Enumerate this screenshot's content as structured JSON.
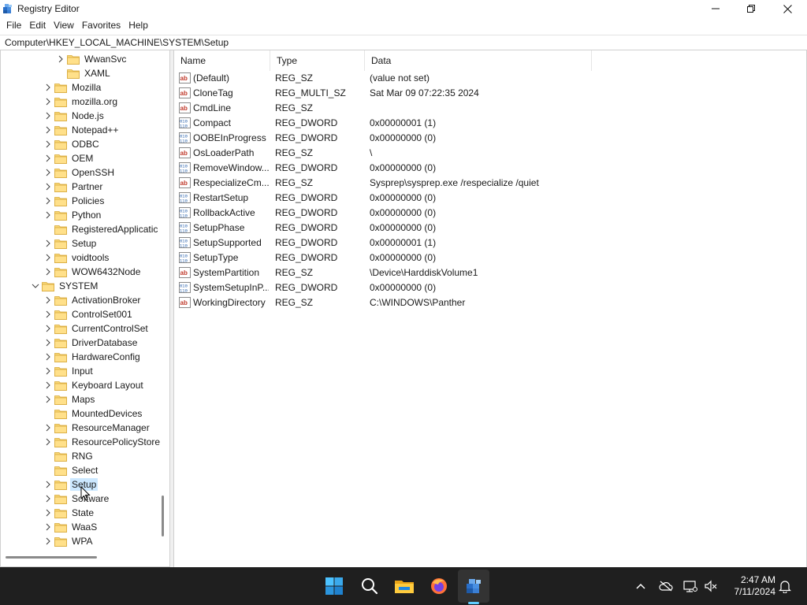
{
  "window": {
    "title": "Registry Editor",
    "controls": {
      "minimize": "minimize",
      "maximize": "maximize",
      "close": "close"
    }
  },
  "menu": [
    "File",
    "Edit",
    "View",
    "Favorites",
    "Help"
  ],
  "address": "Computer\\HKEY_LOCAL_MACHINE\\SYSTEM\\Setup",
  "tree": [
    {
      "label": "WwanSvc",
      "expander": "collapsed",
      "level": 3
    },
    {
      "label": "XAML",
      "expander": "none",
      "level": 3
    },
    {
      "label": "Mozilla",
      "expander": "collapsed",
      "level": 2
    },
    {
      "label": "mozilla.org",
      "expander": "collapsed",
      "level": 2
    },
    {
      "label": "Node.js",
      "expander": "collapsed",
      "level": 2
    },
    {
      "label": "Notepad++",
      "expander": "collapsed",
      "level": 2
    },
    {
      "label": "ODBC",
      "expander": "collapsed",
      "level": 2
    },
    {
      "label": "OEM",
      "expander": "collapsed",
      "level": 2
    },
    {
      "label": "OpenSSH",
      "expander": "collapsed",
      "level": 2
    },
    {
      "label": "Partner",
      "expander": "collapsed",
      "level": 2
    },
    {
      "label": "Policies",
      "expander": "collapsed",
      "level": 2
    },
    {
      "label": "Python",
      "expander": "collapsed",
      "level": 2
    },
    {
      "label": "RegisteredApplicatic",
      "expander": "none",
      "level": 2
    },
    {
      "label": "Setup",
      "expander": "collapsed",
      "level": 2
    },
    {
      "label": "voidtools",
      "expander": "collapsed",
      "level": 2
    },
    {
      "label": "WOW6432Node",
      "expander": "collapsed",
      "level": 2
    },
    {
      "label": "SYSTEM",
      "expander": "expanded",
      "level": 1
    },
    {
      "label": "ActivationBroker",
      "expander": "collapsed",
      "level": 2
    },
    {
      "label": "ControlSet001",
      "expander": "collapsed",
      "level": 2
    },
    {
      "label": "CurrentControlSet",
      "expander": "collapsed",
      "level": 2
    },
    {
      "label": "DriverDatabase",
      "expander": "collapsed",
      "level": 2
    },
    {
      "label": "HardwareConfig",
      "expander": "collapsed",
      "level": 2
    },
    {
      "label": "Input",
      "expander": "collapsed",
      "level": 2
    },
    {
      "label": "Keyboard Layout",
      "expander": "collapsed",
      "level": 2
    },
    {
      "label": "Maps",
      "expander": "collapsed",
      "level": 2
    },
    {
      "label": "MountedDevices",
      "expander": "none",
      "level": 2
    },
    {
      "label": "ResourceManager",
      "expander": "collapsed",
      "level": 2
    },
    {
      "label": "ResourcePolicyStore",
      "expander": "collapsed",
      "level": 2
    },
    {
      "label": "RNG",
      "expander": "none",
      "level": 2
    },
    {
      "label": "Select",
      "expander": "none",
      "level": 2
    },
    {
      "label": "Setup",
      "expander": "collapsed",
      "level": 2,
      "selected": true
    },
    {
      "label": "Software",
      "expander": "collapsed",
      "level": 2
    },
    {
      "label": "State",
      "expander": "collapsed",
      "level": 2
    },
    {
      "label": "WaaS",
      "expander": "collapsed",
      "level": 2
    },
    {
      "label": "WPA",
      "expander": "collapsed",
      "level": 2
    }
  ],
  "list": {
    "columns": [
      "Name",
      "Type",
      "Data"
    ],
    "rows": [
      {
        "name": "(Default)",
        "type": "REG_SZ",
        "data": "(value not set)",
        "icon": "string"
      },
      {
        "name": "CloneTag",
        "type": "REG_MULTI_SZ",
        "data": "Sat Mar 09 07:22:35 2024",
        "icon": "string"
      },
      {
        "name": "CmdLine",
        "type": "REG_SZ",
        "data": "",
        "icon": "string"
      },
      {
        "name": "Compact",
        "type": "REG_DWORD",
        "data": "0x00000001 (1)",
        "icon": "binary"
      },
      {
        "name": "OOBEInProgress",
        "type": "REG_DWORD",
        "data": "0x00000000 (0)",
        "icon": "binary"
      },
      {
        "name": "OsLoaderPath",
        "type": "REG_SZ",
        "data": "\\",
        "icon": "string"
      },
      {
        "name": "RemoveWindow...",
        "type": "REG_DWORD",
        "data": "0x00000000 (0)",
        "icon": "binary"
      },
      {
        "name": "RespecializeCm...",
        "type": "REG_SZ",
        "data": "Sysprep\\sysprep.exe /respecialize /quiet",
        "icon": "string"
      },
      {
        "name": "RestartSetup",
        "type": "REG_DWORD",
        "data": "0x00000000 (0)",
        "icon": "binary"
      },
      {
        "name": "RollbackActive",
        "type": "REG_DWORD",
        "data": "0x00000000 (0)",
        "icon": "binary"
      },
      {
        "name": "SetupPhase",
        "type": "REG_DWORD",
        "data": "0x00000000 (0)",
        "icon": "binary"
      },
      {
        "name": "SetupSupported",
        "type": "REG_DWORD",
        "data": "0x00000001 (1)",
        "icon": "binary"
      },
      {
        "name": "SetupType",
        "type": "REG_DWORD",
        "data": "0x00000000 (0)",
        "icon": "binary"
      },
      {
        "name": "SystemPartition",
        "type": "REG_SZ",
        "data": "\\Device\\HarddiskVolume1",
        "icon": "string"
      },
      {
        "name": "SystemSetupInP...",
        "type": "REG_DWORD",
        "data": "0x00000000 (0)",
        "icon": "binary"
      },
      {
        "name": "WorkingDirectory",
        "type": "REG_SZ",
        "data": "C:\\WINDOWS\\Panther",
        "icon": "string"
      }
    ]
  },
  "taskbar": {
    "apps": [
      "start-icon",
      "search-icon",
      "file-explorer-icon",
      "firefox-icon",
      "registry-editor-icon"
    ],
    "active_app": "registry-editor-icon",
    "tray": [
      "chevron-up-icon",
      "cloud-offline-icon",
      "network-icon",
      "volume-muted-icon",
      "notification-bell-icon"
    ],
    "time": "2:47 AM",
    "date": "7/11/2024"
  },
  "colors": {
    "taskbar": "#1f1f1f",
    "selection": "#cce8ff",
    "folder": "#f8d775",
    "accent": "#60cdff"
  }
}
